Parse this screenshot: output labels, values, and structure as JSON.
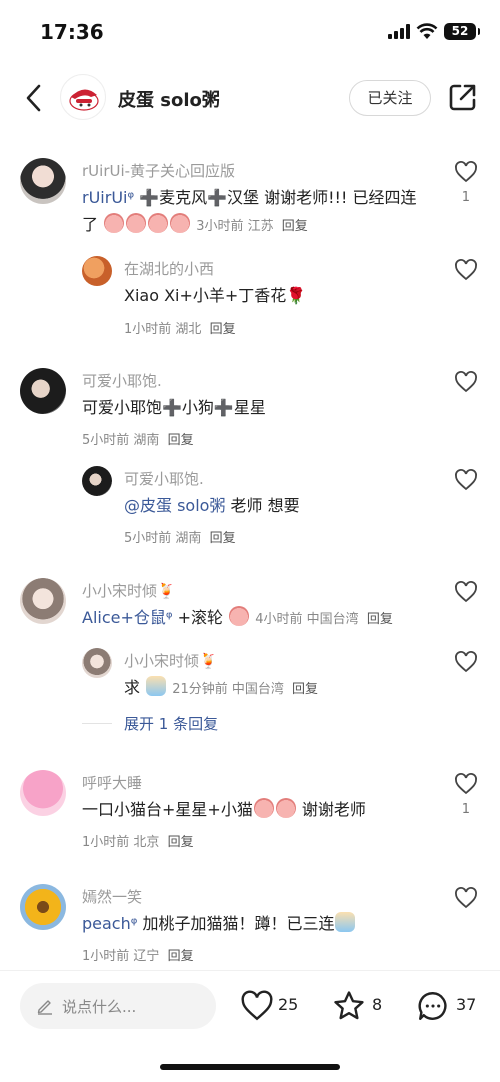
{
  "status": {
    "time": "17:36",
    "battery": "52"
  },
  "header": {
    "title": "皮蛋 solo粥",
    "follow_label": "已关注"
  },
  "comments": [
    {
      "name": "rUirUi-黄子关心回应版",
      "mention": "rUirUiᵠ",
      "text_a": " ➕麦克风➕汉堡 谢谢老师!!! 已经四连了",
      "meta_time": "3小时前",
      "meta_loc": "江苏",
      "reply_label": "回复",
      "like_count": "1"
    },
    {
      "name": "在湖北的小西",
      "text": "Xiao Xi+小羊+丁香花🌹",
      "meta_time": "1小时前",
      "meta_loc": "湖北",
      "reply_label": "回复"
    },
    {
      "name": "可爱小耶饱.",
      "text": "可爱小耶饱➕小狗➕星星",
      "meta_time": "5小时前",
      "meta_loc": "湖南",
      "reply_label": "回复"
    },
    {
      "name": "可爱小耶饱.",
      "mention": "@皮蛋 solo粥",
      "text": " 老师 想要",
      "meta_time": "5小时前",
      "meta_loc": "湖南",
      "reply_label": "回复"
    },
    {
      "name": "小小宋时倾🍹",
      "mention": "Alice+仓鼠ᵠ",
      "text": " +滚轮",
      "meta_time": "4小时前",
      "meta_loc": "中国台湾",
      "reply_label": "回复"
    },
    {
      "name": "小小宋时倾🍹",
      "text": "求",
      "meta_time": "21分钟前",
      "meta_loc": "中国台湾",
      "reply_label": "回复"
    },
    {
      "name": "呼呼大睡",
      "text": "一口小猫台+星星+小猫",
      "text_b": " 谢谢老师",
      "meta_time": "1小时前",
      "meta_loc": "北京",
      "reply_label": "回复",
      "like_count": "1"
    },
    {
      "name": "嫣然一笑",
      "mention": "peachᵠ",
      "text": " 加桃子加猫猫！蹲！已三连",
      "meta_time": "1小时前",
      "meta_loc": "辽宁",
      "reply_label": "回复"
    }
  ],
  "expand_label": "展开 1 条回复",
  "bottom": {
    "placeholder": "说点什么...",
    "likes": "25",
    "stars": "8",
    "comments": "37"
  },
  "colors": {
    "accent": "#3b5998",
    "meta": "#888888"
  },
  "icons": [
    "back-icon",
    "share-icon",
    "heart-icon",
    "star-icon",
    "chat-bubble-icon",
    "pencil-icon"
  ]
}
